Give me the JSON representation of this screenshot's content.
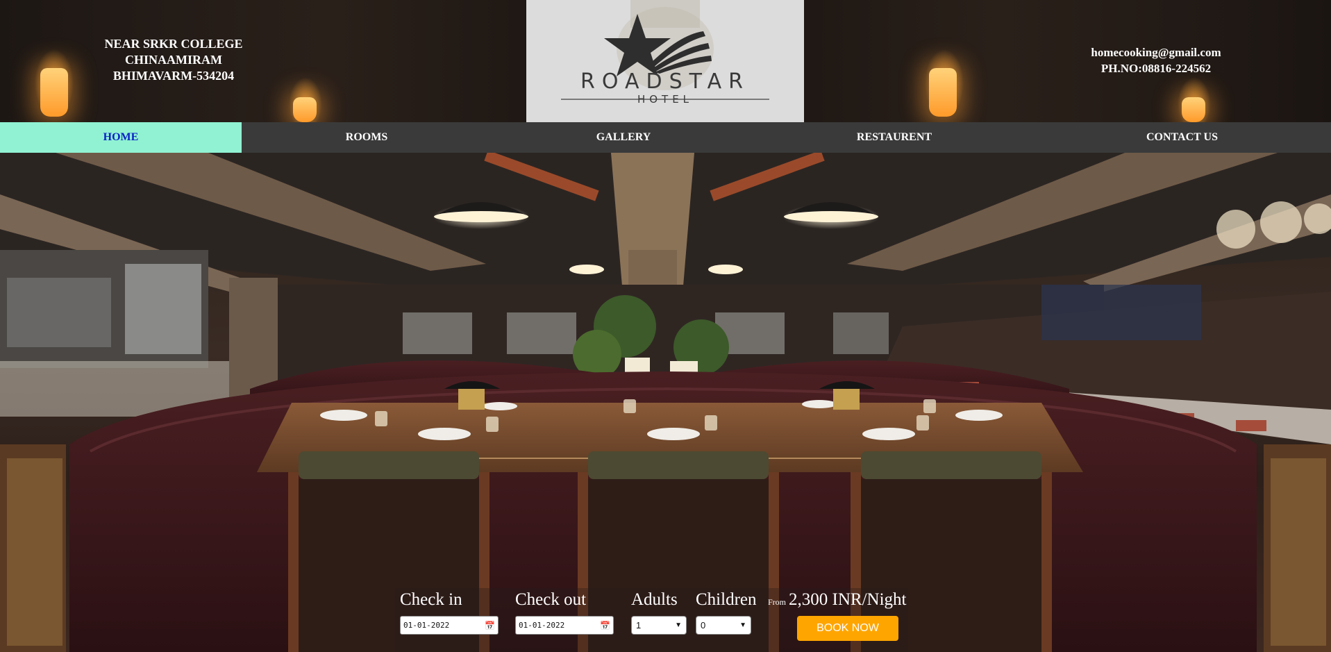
{
  "header": {
    "address": [
      "NEAR SRKR COLLEGE",
      "CHINAAMIRAM",
      "BHIMAVARM-534204"
    ],
    "email": "homecooking@gmail.com",
    "phone": "PH.NO:08816-224562",
    "logo_word": "ROADSTAR",
    "logo_sub": "HOTEL"
  },
  "nav": {
    "items": [
      {
        "label": "HOME",
        "active": true
      },
      {
        "label": "ROOMS",
        "active": false
      },
      {
        "label": "GALLERY",
        "active": false
      },
      {
        "label": "RESTAURENT",
        "active": false
      },
      {
        "label": "CONTACT US",
        "active": false
      }
    ]
  },
  "booking": {
    "checkin_label": "Check in",
    "checkin_value": "01-01-2022",
    "checkout_label": "Check out",
    "checkout_value": "01-01-2022",
    "adults_label": "Adults",
    "adults_value": "1",
    "children_label": "Children",
    "children_value": "0",
    "price_from": "From",
    "price_amount": "2,300 INR/Night",
    "book_label": "BOOK NOW"
  },
  "colors": {
    "nav_active_bg": "#90f2d2",
    "nav_active_text": "#0a1fc8",
    "nav_bg": "#3a3a3a",
    "book_button": "#ffa500"
  },
  "icons": [
    "calendar-icon",
    "chevron-down-icon",
    "star-logo-icon"
  ]
}
